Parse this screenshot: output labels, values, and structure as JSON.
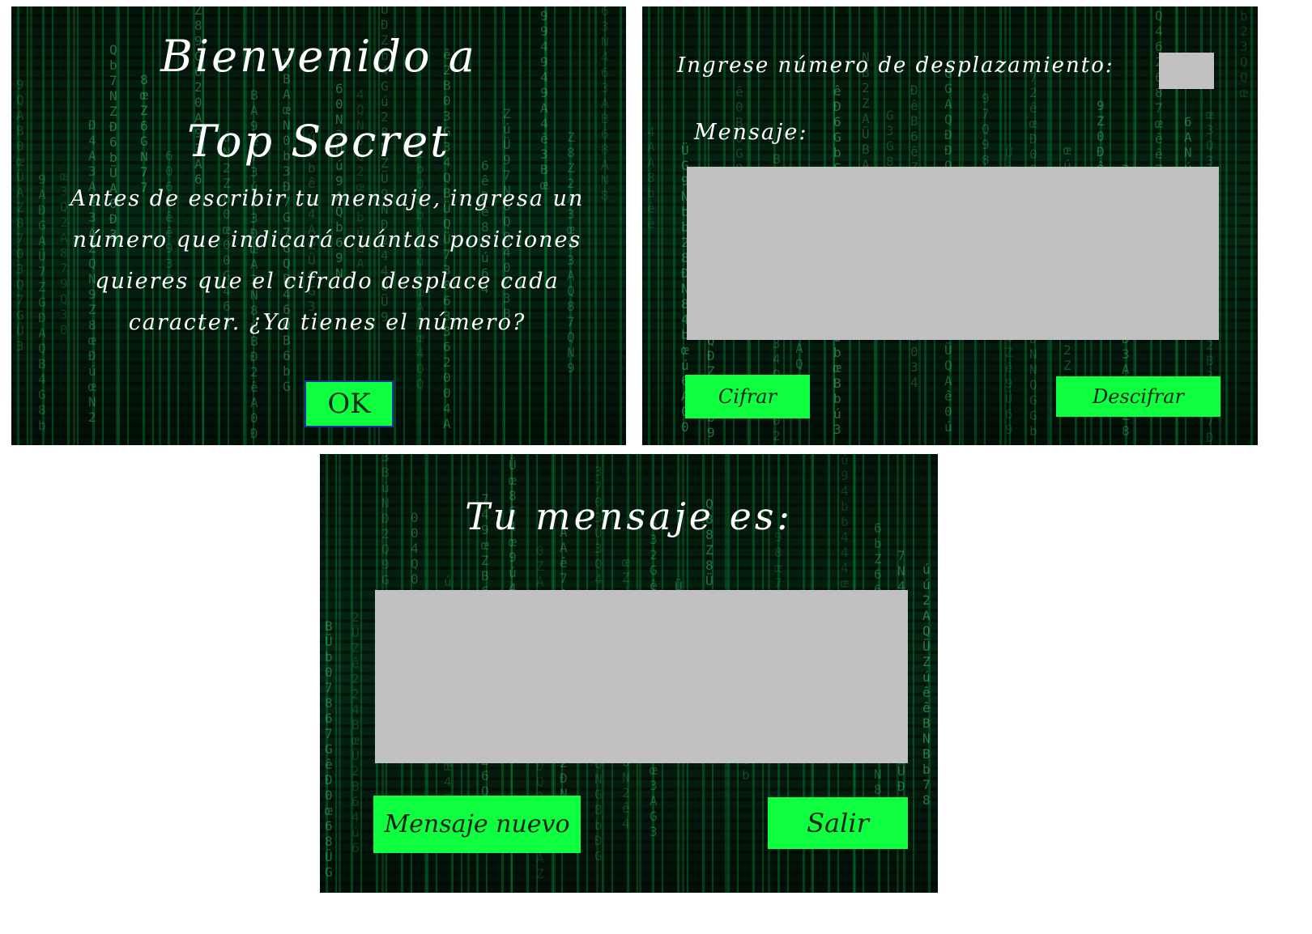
{
  "screen_welcome": {
    "title_line1": "Bienvenido a",
    "title_line2": "Top Secret",
    "body": "Antes de escribir tu mensaje, ingresa un número que indicará cuántas posiciones quieres que el cifrado desplace cada caracter. ¿Ya tienes el número?",
    "ok_label": "OK"
  },
  "screen_input": {
    "shift_label": "Ingrese número de desplazamiento:",
    "shift_value": "",
    "message_label": "Mensaje:",
    "message_value": "",
    "encrypt_label": "Cifrar",
    "decrypt_label": "Descifrar"
  },
  "screen_result": {
    "title": "Tu mensaje es:",
    "result_value": "",
    "new_message_label": "Mensaje nuevo",
    "exit_label": "Salir"
  },
  "colors": {
    "background": "#010a04",
    "matrix_green": "#00c850",
    "button_green": "#0dff3f",
    "field_grey": "#c1c1c1",
    "text_white": "#ffffff",
    "ok_border": "#1c2f9e"
  },
  "decor": {
    "background_glyphs": [
      "6",
      "0",
      "9",
      "G",
      "Q",
      "Z",
      "4",
      "b",
      "A",
      "3",
      "B",
      "Ü",
      "2",
      "7",
      "N",
      "8",
      "ê",
      "œ",
      "ú",
      "Ð"
    ]
  }
}
